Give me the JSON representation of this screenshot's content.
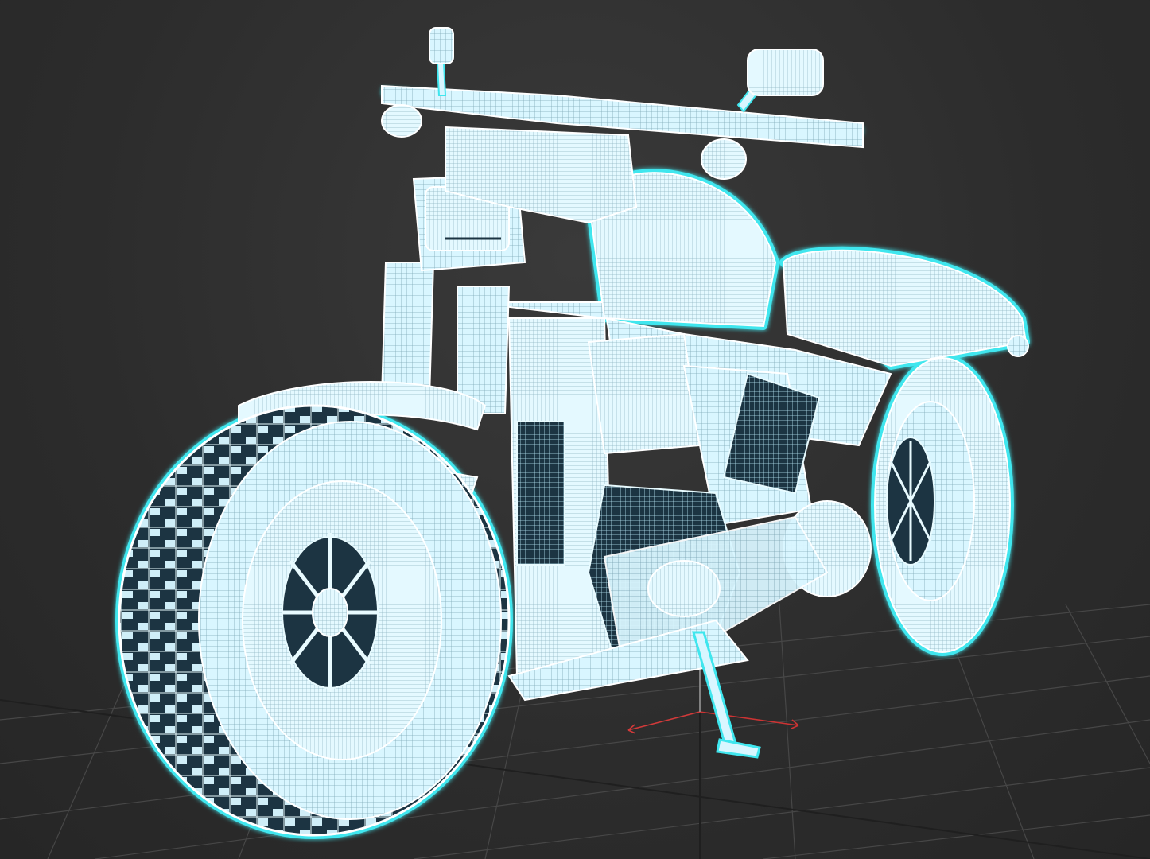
{
  "viewport": {
    "mode": "wireframe",
    "background_color": "#2f2f2f",
    "grid_color": "#4a4a4a",
    "grid_major_color": "#1a1a1a",
    "wire_color": "#d9f6ff",
    "select_outline_color": "#3fe6ee",
    "dark_fill_color": "#1c3442",
    "gizmo_x_color": "#d23a3a",
    "gizmo_y_color": "#cc3333"
  },
  "model": {
    "object": "motorcycle",
    "icon": "motorcycle-wireframe-icon"
  },
  "gizmo": {
    "icon": "transform-gizmo-icon"
  }
}
